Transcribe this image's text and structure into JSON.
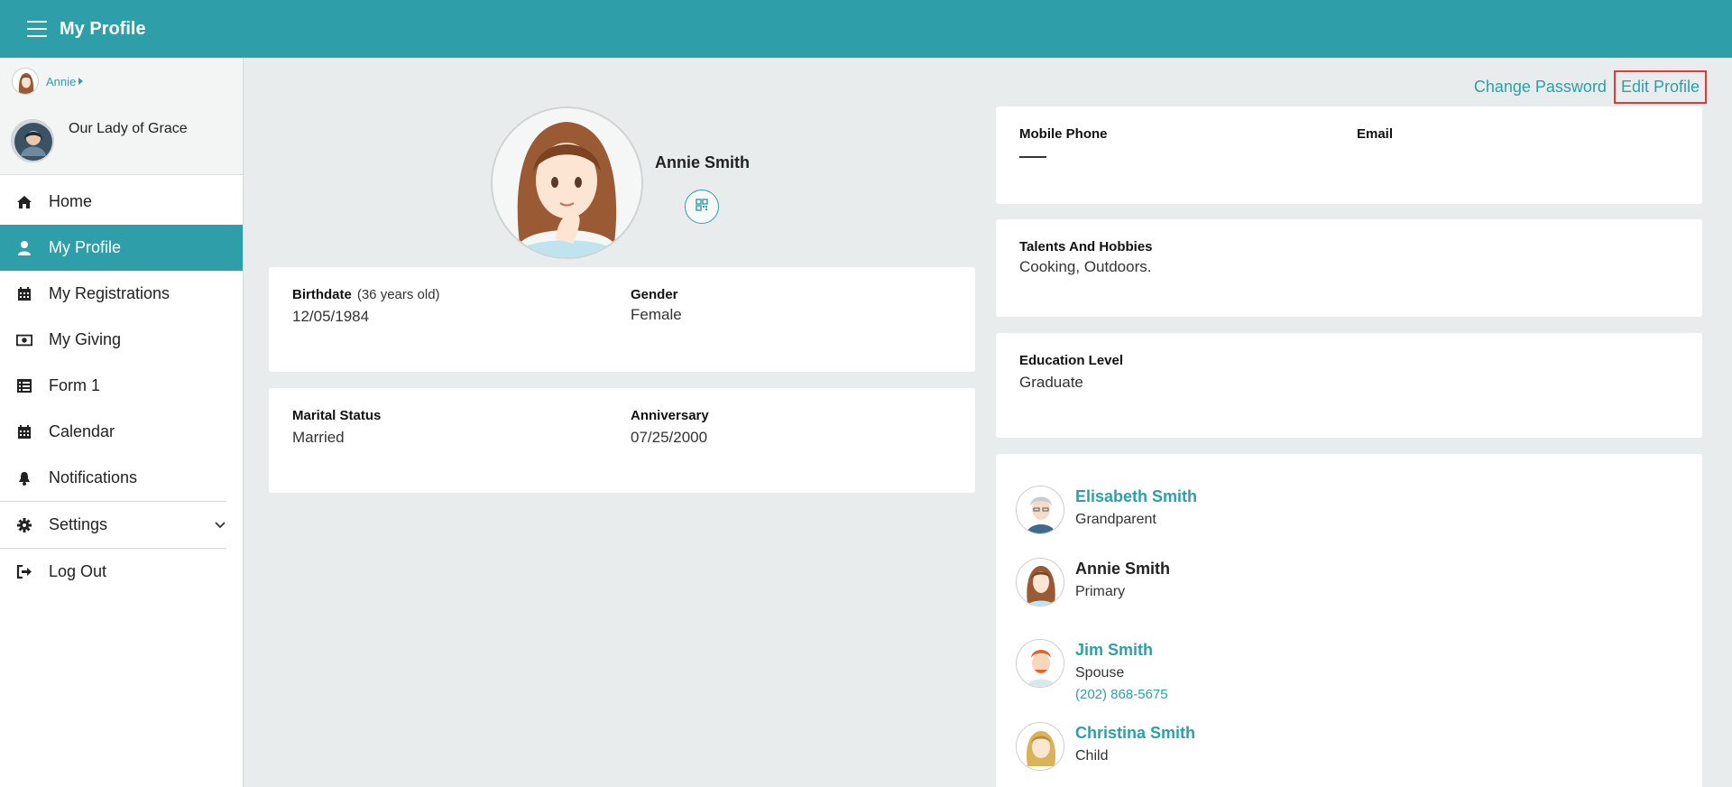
{
  "header": {
    "title": "My Profile",
    "menu_icon": "hamburger-icon"
  },
  "sidebar": {
    "user": {
      "name": "Annie"
    },
    "parish": {
      "name": "Our Lady of Grace"
    },
    "items": [
      {
        "label": "Home",
        "icon": "home-icon"
      },
      {
        "label": "My Profile",
        "icon": "user-icon",
        "active": true
      },
      {
        "label": "My Registrations",
        "icon": "calendar-icon"
      },
      {
        "label": "My Giving",
        "icon": "money-icon"
      },
      {
        "label": "Form 1",
        "icon": "form-list-icon"
      },
      {
        "label": "Calendar",
        "icon": "calendar-icon"
      },
      {
        "label": "Notifications",
        "icon": "bell-icon"
      },
      {
        "label": "Settings",
        "icon": "gear-icon"
      },
      {
        "label": "Log Out",
        "icon": "logout-icon"
      }
    ]
  },
  "actions": {
    "change_password": "Change Password",
    "edit_profile": "Edit Profile"
  },
  "profile": {
    "name": "Annie Smith",
    "birthdate_label": "Birthdate",
    "age": "(36 years old)",
    "birthdate": "12/05/1984",
    "gender_label": "Gender",
    "gender": "Female",
    "marital_label": "Marital Status",
    "marital": "Married",
    "anniversary_label": "Anniversary",
    "anniversary": "07/25/2000"
  },
  "contact": {
    "mobile_label": "Mobile Phone",
    "email_label": "Email"
  },
  "talents": {
    "label": "Talents And Hobbies",
    "value": "Cooking, Outdoors."
  },
  "education": {
    "label": "Education Level",
    "value": "Graduate"
  },
  "family": [
    {
      "name": "Elisabeth Smith",
      "relation": "Grandparent"
    },
    {
      "name": "Annie Smith",
      "relation": "Primary"
    },
    {
      "name": "Jim Smith",
      "relation": "Spouse",
      "phone": "(202) 868-5675"
    },
    {
      "name": "Christina Smith",
      "relation": "Child"
    }
  ],
  "colors": {
    "accent": "#2e9ea8",
    "highlight": "#e33333",
    "background": "#e9ecec"
  }
}
